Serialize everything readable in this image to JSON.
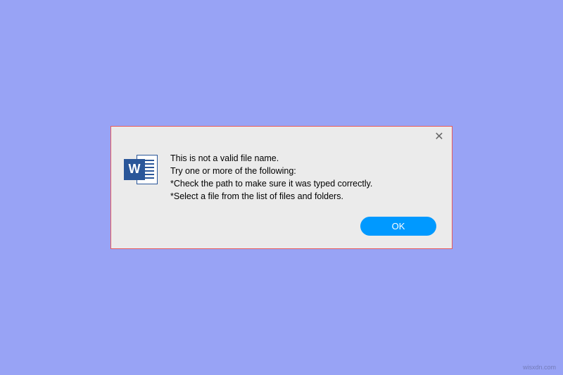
{
  "dialog": {
    "close_symbol": "✕",
    "message": {
      "line1": "This is not a valid file name.",
      "line2": "Try one or more of the following:",
      "line3": "*Check the path to make sure it was typed correctly.",
      "line4": "*Select a file from the list of files and folders."
    },
    "icon": {
      "letter": "W"
    },
    "ok_label": "OK"
  },
  "watermark": "wisxdn.com"
}
